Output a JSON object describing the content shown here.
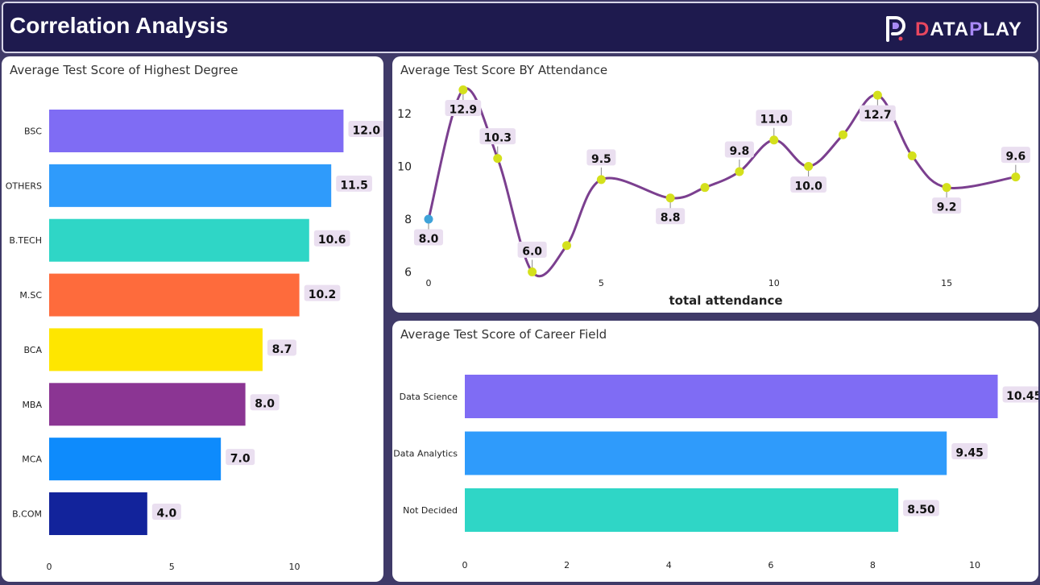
{
  "header": {
    "title": "Correlation Analysis",
    "logo_text_parts": [
      "D",
      "ATA",
      "P",
      "LAY"
    ],
    "logo_colors": [
      "#e8475f",
      "#ffffff",
      "#a889f5",
      "#ffffff"
    ]
  },
  "panels": {
    "degree": {
      "title": "Average Test Score of Highest Degree"
    },
    "attendance": {
      "title": "Average Test Score BY Attendance"
    },
    "career": {
      "title": "Average Test Score of Career Field"
    }
  },
  "colors": {
    "background": "#3f3a68",
    "header": "#1e1a4e",
    "line": "#7b3f8f",
    "marker": "#d4e01c",
    "marker_first": "#3fa3d9",
    "label_bg": "#eadff0"
  },
  "chart_data": [
    {
      "id": "degree",
      "type": "bar",
      "orientation": "horizontal",
      "title": "Average Test Score of Highest Degree",
      "categories": [
        "BSC",
        "OTHERS",
        "B.TECH",
        "M.SC",
        "BCA",
        "MBA",
        "MCA",
        "B.COM"
      ],
      "values": [
        12.0,
        11.5,
        10.6,
        10.2,
        8.7,
        8.0,
        7.0,
        4.0
      ],
      "value_labels": [
        "12.0",
        "11.5",
        "10.6",
        "10.2",
        "8.7",
        "8.0",
        "7.0",
        "4.0"
      ],
      "colors": [
        "#7f6cf4",
        "#2f9bfb",
        "#2fd6c6",
        "#fe6b3c",
        "#fee600",
        "#8b3593",
        "#0e8bfc",
        "#12239b"
      ],
      "xlim": [
        0,
        13.3
      ],
      "x_ticks": [
        0,
        5,
        10
      ],
      "x_tick_labels": [
        "0",
        "5",
        "10"
      ],
      "grid": false
    },
    {
      "id": "attendance",
      "type": "line",
      "title": "Average Test Score BY Attendance",
      "xlabel": "total attendance",
      "x": [
        0,
        1,
        2,
        3,
        4,
        5,
        7,
        8,
        9,
        10,
        11,
        12,
        13,
        14,
        15,
        17
      ],
      "y": [
        8.0,
        12.9,
        10.3,
        6.0,
        7.0,
        9.5,
        8.8,
        9.2,
        9.8,
        11.0,
        10.0,
        11.2,
        12.7,
        10.4,
        9.2,
        9.6
      ],
      "point_labels": [
        "8.0",
        "12.9",
        "10.3",
        "6.0",
        "",
        "9.5",
        "8.8",
        "",
        "9.8",
        "11.0",
        "10.0",
        "",
        "12.7",
        "",
        "9.2",
        "9.6"
      ],
      "label_position": [
        "below",
        "below",
        "above",
        "above",
        "",
        "above",
        "below",
        "",
        "above",
        "above",
        "below",
        "",
        "below",
        "",
        "below",
        "above"
      ],
      "xlim": [
        0,
        17.4
      ],
      "ylim": [
        5.5,
        13.1
      ],
      "x_ticks": [
        0,
        5,
        10,
        15
      ],
      "x_tick_labels": [
        "0",
        "5",
        "10",
        "15"
      ],
      "y_ticks": [
        6,
        8,
        10,
        12
      ],
      "y_tick_labels": [
        "6",
        "8",
        "10",
        "12"
      ],
      "grid": false
    },
    {
      "id": "career",
      "type": "bar",
      "orientation": "horizontal",
      "title": "Average Test Score of Career Field",
      "categories": [
        "Data Science",
        "Data Analytics",
        "Not Decided"
      ],
      "values": [
        10.45,
        9.45,
        8.5
      ],
      "value_labels": [
        "10.45",
        "9.45",
        "8.50"
      ],
      "colors": [
        "#7f6cf4",
        "#2f9bfb",
        "#2fd6c6"
      ],
      "xlim": [
        0,
        11.2
      ],
      "x_ticks": [
        0,
        2,
        4,
        6,
        8,
        10
      ],
      "x_tick_labels": [
        "0",
        "2",
        "4",
        "6",
        "8",
        "10"
      ],
      "grid": false
    }
  ]
}
